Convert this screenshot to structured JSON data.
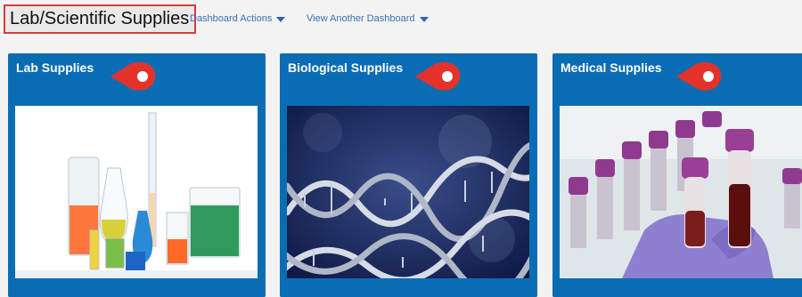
{
  "header": {
    "title": "Lab/Scientific Supplies",
    "dashboard_actions": "Dashboard Actions",
    "view_another": "View Another Dashboard"
  },
  "cards": [
    {
      "title": "Lab Supplies",
      "image": "lab-glassware-photo"
    },
    {
      "title": "Biological Supplies",
      "image": "dna-helix-photo"
    },
    {
      "title": "Medical Supplies",
      "image": "blood-test-tubes-photo"
    }
  ],
  "colors": {
    "card_blue": "#0a6db3",
    "pin_red": "#e4322b",
    "highlight_border": "#d83b3b",
    "link_blue": "#3a6fb6"
  }
}
